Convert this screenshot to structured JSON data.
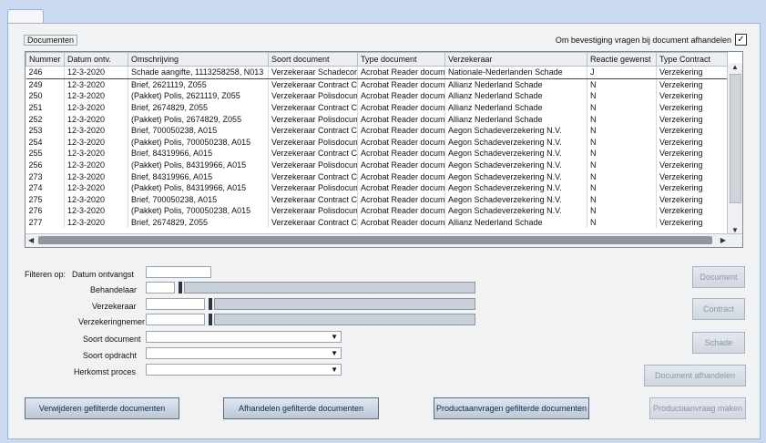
{
  "window": {
    "tab_label": ""
  },
  "group": {
    "title": "Documenten",
    "confirm_label": "Om bevestiging vragen bij document afhandelen",
    "confirm_checked": "✓"
  },
  "table": {
    "columns": [
      "Nummer",
      "Datum ontv.",
      "Omschrijving",
      "Soort document",
      "Type document",
      "Verzekeraar",
      "Reactie gewenst",
      "Type Contract"
    ],
    "rows": [
      [
        "246",
        "12-3-2020",
        "Schade aangifte, 1113258258, N013",
        "Verzekeraar Schadecor",
        "Acrobat Reader docum",
        "Nationale-Nederlanden Schade",
        "J",
        "Verzekering"
      ],
      [
        "249",
        "12-3-2020",
        "Brief, 2621119, Z055",
        "Verzekeraar Contract Ci",
        "Acrobat Reader docum",
        "Allianz Nederland Schade",
        "N",
        "Verzekering"
      ],
      [
        "250",
        "12-3-2020",
        "(Pakket) Polis, 2621119, Z055",
        "Verzekeraar Polisdocum",
        "Acrobat Reader docum",
        "Allianz Nederland Schade",
        "N",
        "Verzekering"
      ],
      [
        "251",
        "12-3-2020",
        "Brief, 2674829, Z055",
        "Verzekeraar Contract Ci",
        "Acrobat Reader docum",
        "Allianz Nederland Schade",
        "N",
        "Verzekering"
      ],
      [
        "252",
        "12-3-2020",
        "(Pakket) Polis, 2674829, Z055",
        "Verzekeraar Polisdocum",
        "Acrobat Reader docum",
        "Allianz Nederland Schade",
        "N",
        "Verzekering"
      ],
      [
        "253",
        "12-3-2020",
        "Brief, 700050238, A015",
        "Verzekeraar Contract Ci",
        "Acrobat Reader docum",
        "Aegon Schadeverzekering N.V.",
        "N",
        "Verzekering"
      ],
      [
        "254",
        "12-3-2020",
        "(Pakket) Polis, 700050238, A015",
        "Verzekeraar Polisdocum",
        "Acrobat Reader docum",
        "Aegon Schadeverzekering N.V.",
        "N",
        "Verzekering"
      ],
      [
        "255",
        "12-3-2020",
        "Brief, 84319966, A015",
        "Verzekeraar Contract Ci",
        "Acrobat Reader docum",
        "Aegon Schadeverzekering N.V.",
        "N",
        "Verzekering"
      ],
      [
        "256",
        "12-3-2020",
        "(Pakket) Polis, 84319966, A015",
        "Verzekeraar Polisdocum",
        "Acrobat Reader docum",
        "Aegon Schadeverzekering N.V.",
        "N",
        "Verzekering"
      ],
      [
        "273",
        "12-3-2020",
        "Brief, 84319966, A015",
        "Verzekeraar Contract Ci",
        "Acrobat Reader docum",
        "Aegon Schadeverzekering N.V.",
        "N",
        "Verzekering"
      ],
      [
        "274",
        "12-3-2020",
        "(Pakket) Polis, 84319966, A015",
        "Verzekeraar Polisdocum",
        "Acrobat Reader docum",
        "Aegon Schadeverzekering N.V.",
        "N",
        "Verzekering"
      ],
      [
        "275",
        "12-3-2020",
        "Brief, 700050238, A015",
        "Verzekeraar Contract Ci",
        "Acrobat Reader docum",
        "Aegon Schadeverzekering N.V.",
        "N",
        "Verzekering"
      ],
      [
        "276",
        "12-3-2020",
        "(Pakket) Polis, 700050238, A015",
        "Verzekeraar Polisdocum",
        "Acrobat Reader docum",
        "Aegon Schadeverzekering N.V.",
        "N",
        "Verzekering"
      ],
      [
        "277",
        "12-3-2020",
        "Brief, 2674829, Z055",
        "Verzekeraar Contract Ci",
        "Acrobat Reader docum",
        "Allianz Nederland Schade",
        "N",
        "Verzekering"
      ]
    ],
    "selected_row": "246"
  },
  "filters": {
    "prefix": "Filteren op:",
    "datum": "Datum ontvangst",
    "behandelaar": "Behandelaar",
    "verzekeraar": "Verzekeraar",
    "verzekeringnemer": "Verzekeringnemer",
    "soort_document": "Soort document",
    "soort_opdracht": "Soort opdracht",
    "herkomst": "Herkomst proces"
  },
  "buttons": {
    "document": "Document",
    "contract": "Contract",
    "schade": "Schade",
    "afhandelen": "Document afhandelen",
    "productaanvraag": "Productaanvraag maken",
    "verwijderen": "Verwijderen gefilterde documenten",
    "afhandelen_gef": "Afhandelen gefilterde documenten",
    "productaanvragen_gef": "Productaanvragen gefilterde documenten"
  }
}
